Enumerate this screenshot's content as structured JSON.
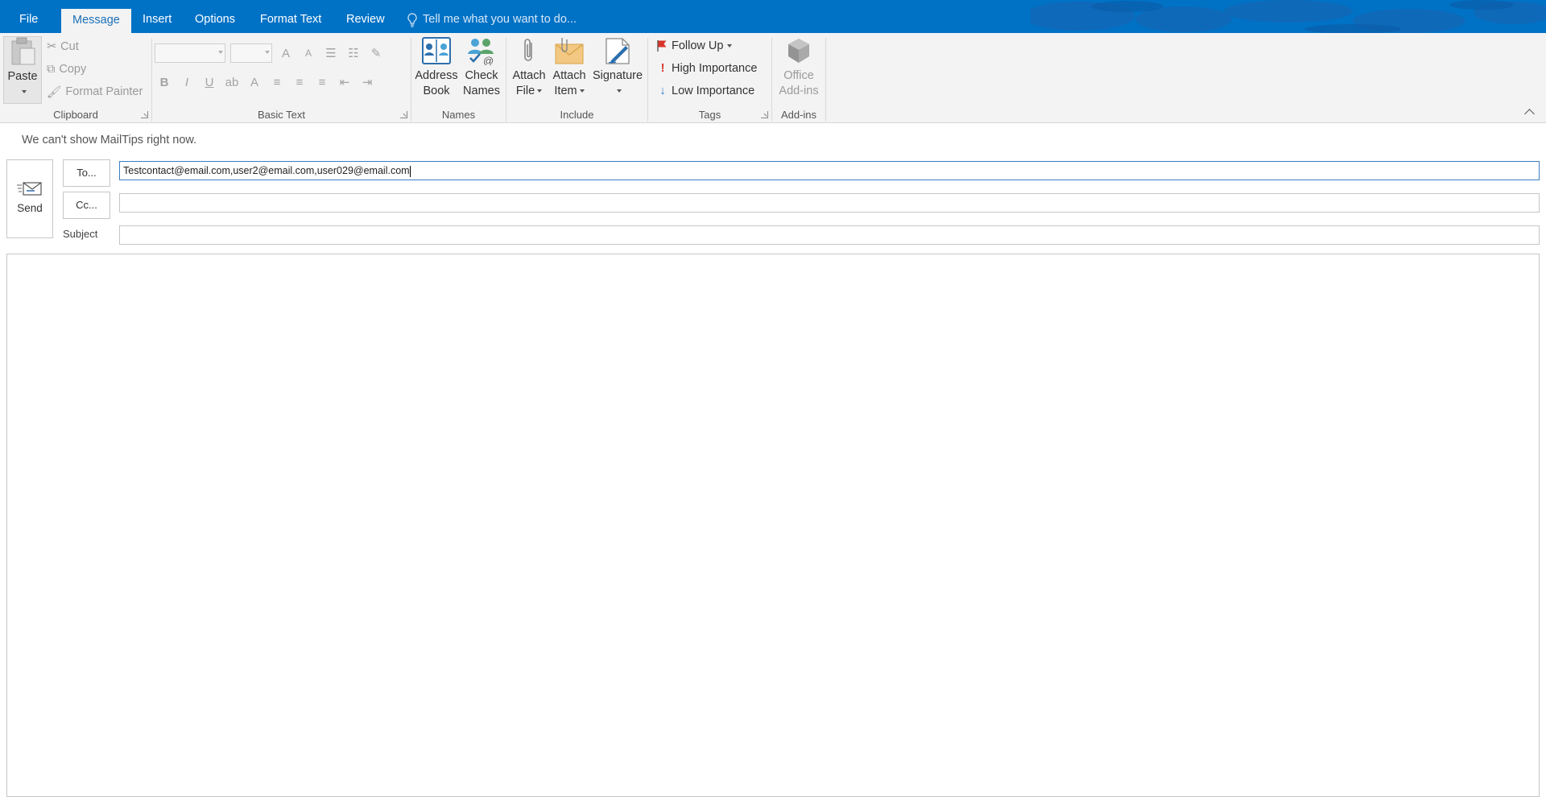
{
  "tabs": {
    "file": "File",
    "message": "Message",
    "insert": "Insert",
    "options": "Options",
    "format_text": "Format Text",
    "review": "Review",
    "tell_me": "Tell me what you want to do..."
  },
  "clipboard": {
    "paste": "Paste",
    "cut": "Cut",
    "copy": "Copy",
    "format_painter": "Format Painter",
    "label": "Clipboard"
  },
  "basic_text": {
    "label": "Basic Text",
    "bold": "B",
    "italic": "I",
    "underline": "U",
    "grow_font": "A",
    "shrink_font": "A",
    "font_color": "A"
  },
  "names": {
    "address_book": [
      "Address",
      "Book"
    ],
    "check_names": [
      "Check",
      "Names"
    ],
    "label": "Names"
  },
  "include": {
    "attach_file": [
      "Attach",
      "File"
    ],
    "attach_item": [
      "Attach",
      "Item"
    ],
    "signature": "Signature",
    "label": "Include"
  },
  "tags": {
    "follow_up": "Follow Up",
    "high_importance": "High Importance",
    "low_importance": "Low Importance",
    "label": "Tags"
  },
  "addins": {
    "office_addins": [
      "Office",
      "Add-ins"
    ],
    "label": "Add-ins"
  },
  "form": {
    "mailtips": "We can't show MailTips right now.",
    "send": "Send",
    "to_button": "To...",
    "cc_button": "Cc...",
    "subject_label": "Subject",
    "to_value": "Testcontact@email.com,user2@email.com,user029@email.com",
    "cc_value": "",
    "subject_value": ""
  },
  "colors": {
    "ribbon_blue": "#0072c6",
    "ribbon_body": "#f3f3f3",
    "follow_up_flag": "#d9342b",
    "high_importance": "#d9342b",
    "low_importance": "#2f7bd0"
  }
}
